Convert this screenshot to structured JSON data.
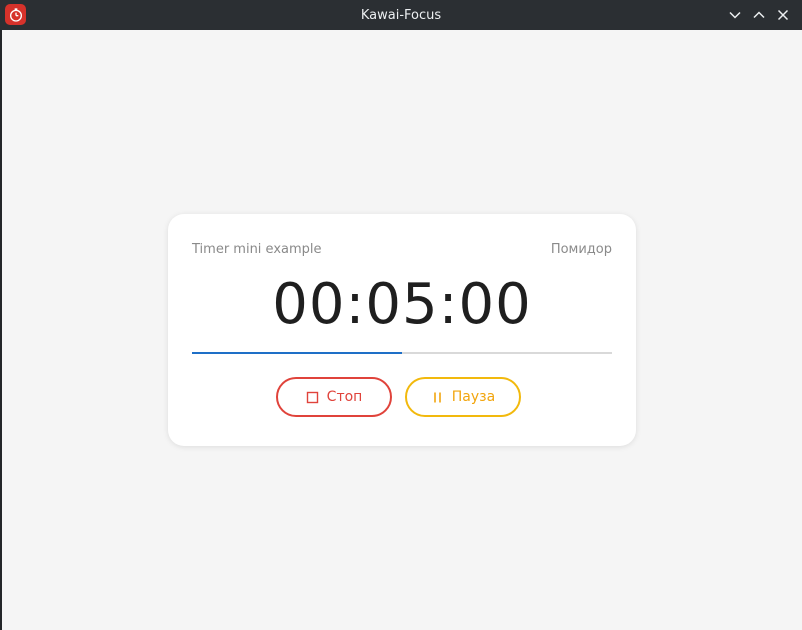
{
  "window": {
    "title": "Kawai-Focus",
    "icons": [
      "app-tomato-timer-icon",
      "minimize-icon",
      "maximize-icon",
      "close-icon"
    ]
  },
  "timer": {
    "name": "Timer mini example",
    "mode": "Помидор",
    "time": "00:05:00",
    "progress": 0.5
  },
  "buttons": {
    "stop_label": "Стоп",
    "pause_label": "Пауза"
  },
  "colors": {
    "titlebar": "#2b2f33",
    "progress": "#1e6fc7",
    "stop": "#e0433b",
    "pause": "#f2b90d"
  }
}
